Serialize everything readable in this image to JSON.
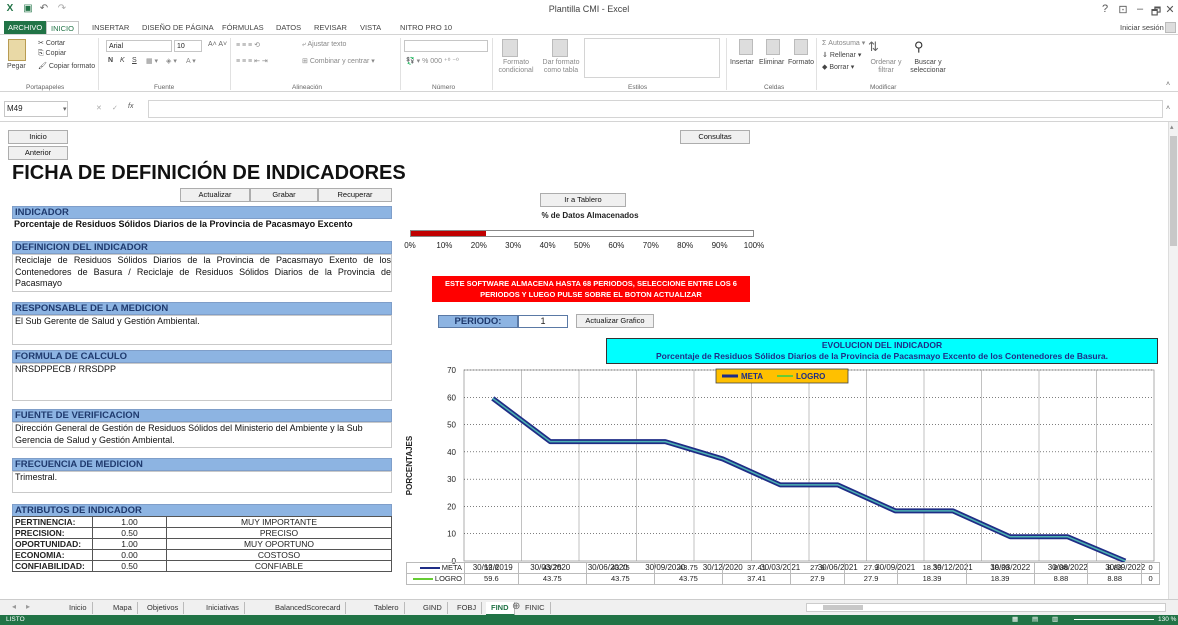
{
  "window": {
    "title": "Plantilla CMI - Excel",
    "help": "?",
    "controls": [
      "⊡",
      "–",
      "🗗",
      "✕"
    ]
  },
  "ribbon_tabs": [
    "ARCHIVO",
    "INICIO",
    "INSERTAR",
    "DISEÑO DE PÁGINA",
    "FÓRMULAS",
    "DATOS",
    "REVISAR",
    "VISTA",
    "NITRO PRO 10"
  ],
  "signin": "Iniciar sesión",
  "ribbon": {
    "paste": "Pegar",
    "cut": "Cortar",
    "copy": "Copiar",
    "copy_format": "Copiar formato",
    "clipboard": "Portapapeles",
    "font_name": "Arial",
    "font_size": "10",
    "font_group": "Fuente",
    "bold": "N",
    "italic": "K",
    "underline": "S",
    "wrap": "Ajustar texto",
    "merge": "Combinar y centrar",
    "align_group": "Alineación",
    "number_group": "Número",
    "cond_format": "Formato condicional",
    "table_format": "Dar formato como tabla",
    "styles_group": "Estilos",
    "insert": "Insertar",
    "delete": "Eliminar",
    "format": "Formato",
    "cells_group": "Celdas",
    "autosum": "Autosuma",
    "fill": "Rellenar",
    "clear": "Borrar",
    "sort": "Ordenar y filtrar",
    "find": "Buscar y seleccionar",
    "modify_group": "Modificar"
  },
  "formula_bar": {
    "name_box": "M49",
    "fx": "fx",
    "value": ""
  },
  "buttons": {
    "inicio": "Inicio",
    "anterior": "Anterior",
    "consultas": "Consultas",
    "actualizar": "Actualizar",
    "grabar": "Grabar",
    "recuperar": "Recuperar",
    "tablero": "Ir a Tablero",
    "actualizar_grafico": "Actualizar Grafico"
  },
  "main_title": "FICHA DE DEFINICIÓN DE INDICADORES",
  "indicador": {
    "label": "INDICADOR",
    "value": "Porcentaje de Residuos Sólidos Diarios de la Provincia de Pacasmayo Excento"
  },
  "definicion": {
    "label": "DEFINICION DEL INDICADOR",
    "value": "Reciclaje de Residuos Sólidos Diarios de la Provincia de Pacasmayo Exento de los Contenedores de Basura / Reciclaje de Residuos Sólidos Diarios de la Provincia de Pacasmayo"
  },
  "responsable": {
    "label": "RESPONSABLE DE LA MEDICION",
    "value": "El Sub Gerente de Salud y Gestión Ambiental."
  },
  "formula": {
    "label": "FORMULA DE CALCULO",
    "value": "NRSDPPECB / RRSDPP"
  },
  "fuente": {
    "label": "FUENTE DE VERIFICACION",
    "value": "Dirección General de Gestión de Residuos Sólidos del Ministerio del Ambiente y la Sub Gerencia de Salud y Gestión Ambiental."
  },
  "frecuencia": {
    "label": "FRECUENCIA DE MEDICION",
    "value": "Trimestral."
  },
  "atributos": {
    "label": "ATRIBUTOS DE INDICADOR",
    "rows": [
      [
        "PERTINENCIA:",
        "1.00",
        "MUY IMPORTANTE"
      ],
      [
        "PRECISION:",
        "0.50",
        "PRECISO"
      ],
      [
        "OPORTUNIDAD:",
        "1.00",
        "MUY OPORTUNO"
      ],
      [
        "ECONOMIA:",
        "0.00",
        "COSTOSO"
      ],
      [
        "CONFIABILIDAD:",
        "0.50",
        "CONFIABLE"
      ]
    ]
  },
  "progress": {
    "label": "% de Datos Almacenados",
    "fraction": 0.22,
    "ticks": [
      "0%",
      "10%",
      "20%",
      "30%",
      "40%",
      "50%",
      "60%",
      "70%",
      "80%",
      "90%",
      "100%"
    ],
    "color": "#c00000"
  },
  "warning": "ESTE SOFTWARE ALMACENA HASTA 68 PERIODOS, SELECCIONE ENTRE LOS 6 PERIODOS Y LUEGO PULSE SOBRE EL BOTON ACTUALIZAR",
  "periodo": {
    "label": "PERIODO:",
    "value": "1"
  },
  "chart_data": {
    "type": "line",
    "title": "EVOLUCION DEL INDICADOR",
    "subtitle": "Porcentaje de Residuos Sólidos Diarios de la Provincia de Pacasmayo Excento de los Contenedores de Basura.",
    "ylabel": "PORCENTAJES",
    "ylim": [
      0,
      70
    ],
    "yticks": [
      0,
      10,
      20,
      30,
      40,
      50,
      60,
      70
    ],
    "categories": [
      "30/12/2019",
      "30/03/2020",
      "30/06/2020",
      "30/09/2020",
      "30/12/2020",
      "30/03/2021",
      "30/06/2021",
      "30/09/2021",
      "30/12/2021",
      "30/03/2022",
      "30/06/2022",
      "30/09/2022"
    ],
    "series": [
      {
        "name": "META",
        "color": "#1f2d86",
        "values": [
          59.6,
          43.75,
          43.75,
          43.75,
          37.41,
          27.9,
          27.9,
          18.39,
          18.39,
          8.88,
          8.88,
          0
        ],
        "labels": [
          "59.6",
          "43.75",
          "43.75",
          "43.75",
          "37.41",
          "27.9",
          "27.9",
          "18.39",
          "18.39",
          "8.88",
          "8.88",
          "0"
        ]
      },
      {
        "name": "LOGRO",
        "color": "#66cc33",
        "values": [
          59.6,
          43.75,
          43.75,
          43.75,
          37.41,
          27.9,
          27.9,
          18.39,
          18.39,
          8.88,
          8.88,
          0
        ],
        "labels": [
          "59.6",
          "43.75",
          "43.75",
          "43.75",
          "37.41",
          "27.9",
          "27.9",
          "18.39",
          "18.39",
          "8.88",
          "8.88",
          "0"
        ]
      }
    ],
    "legend": "top-center",
    "grid": true
  },
  "sheet_tabs": [
    "Inicio",
    "Mapa",
    "Objetivos",
    "Iniciativas",
    "BalancedScorecard",
    "Tablero",
    "GIND",
    "FOBJ",
    "FIND",
    "FINIC"
  ],
  "active_sheet": "FIND",
  "status": {
    "ready": "LISTO",
    "zoom": "130 %"
  }
}
